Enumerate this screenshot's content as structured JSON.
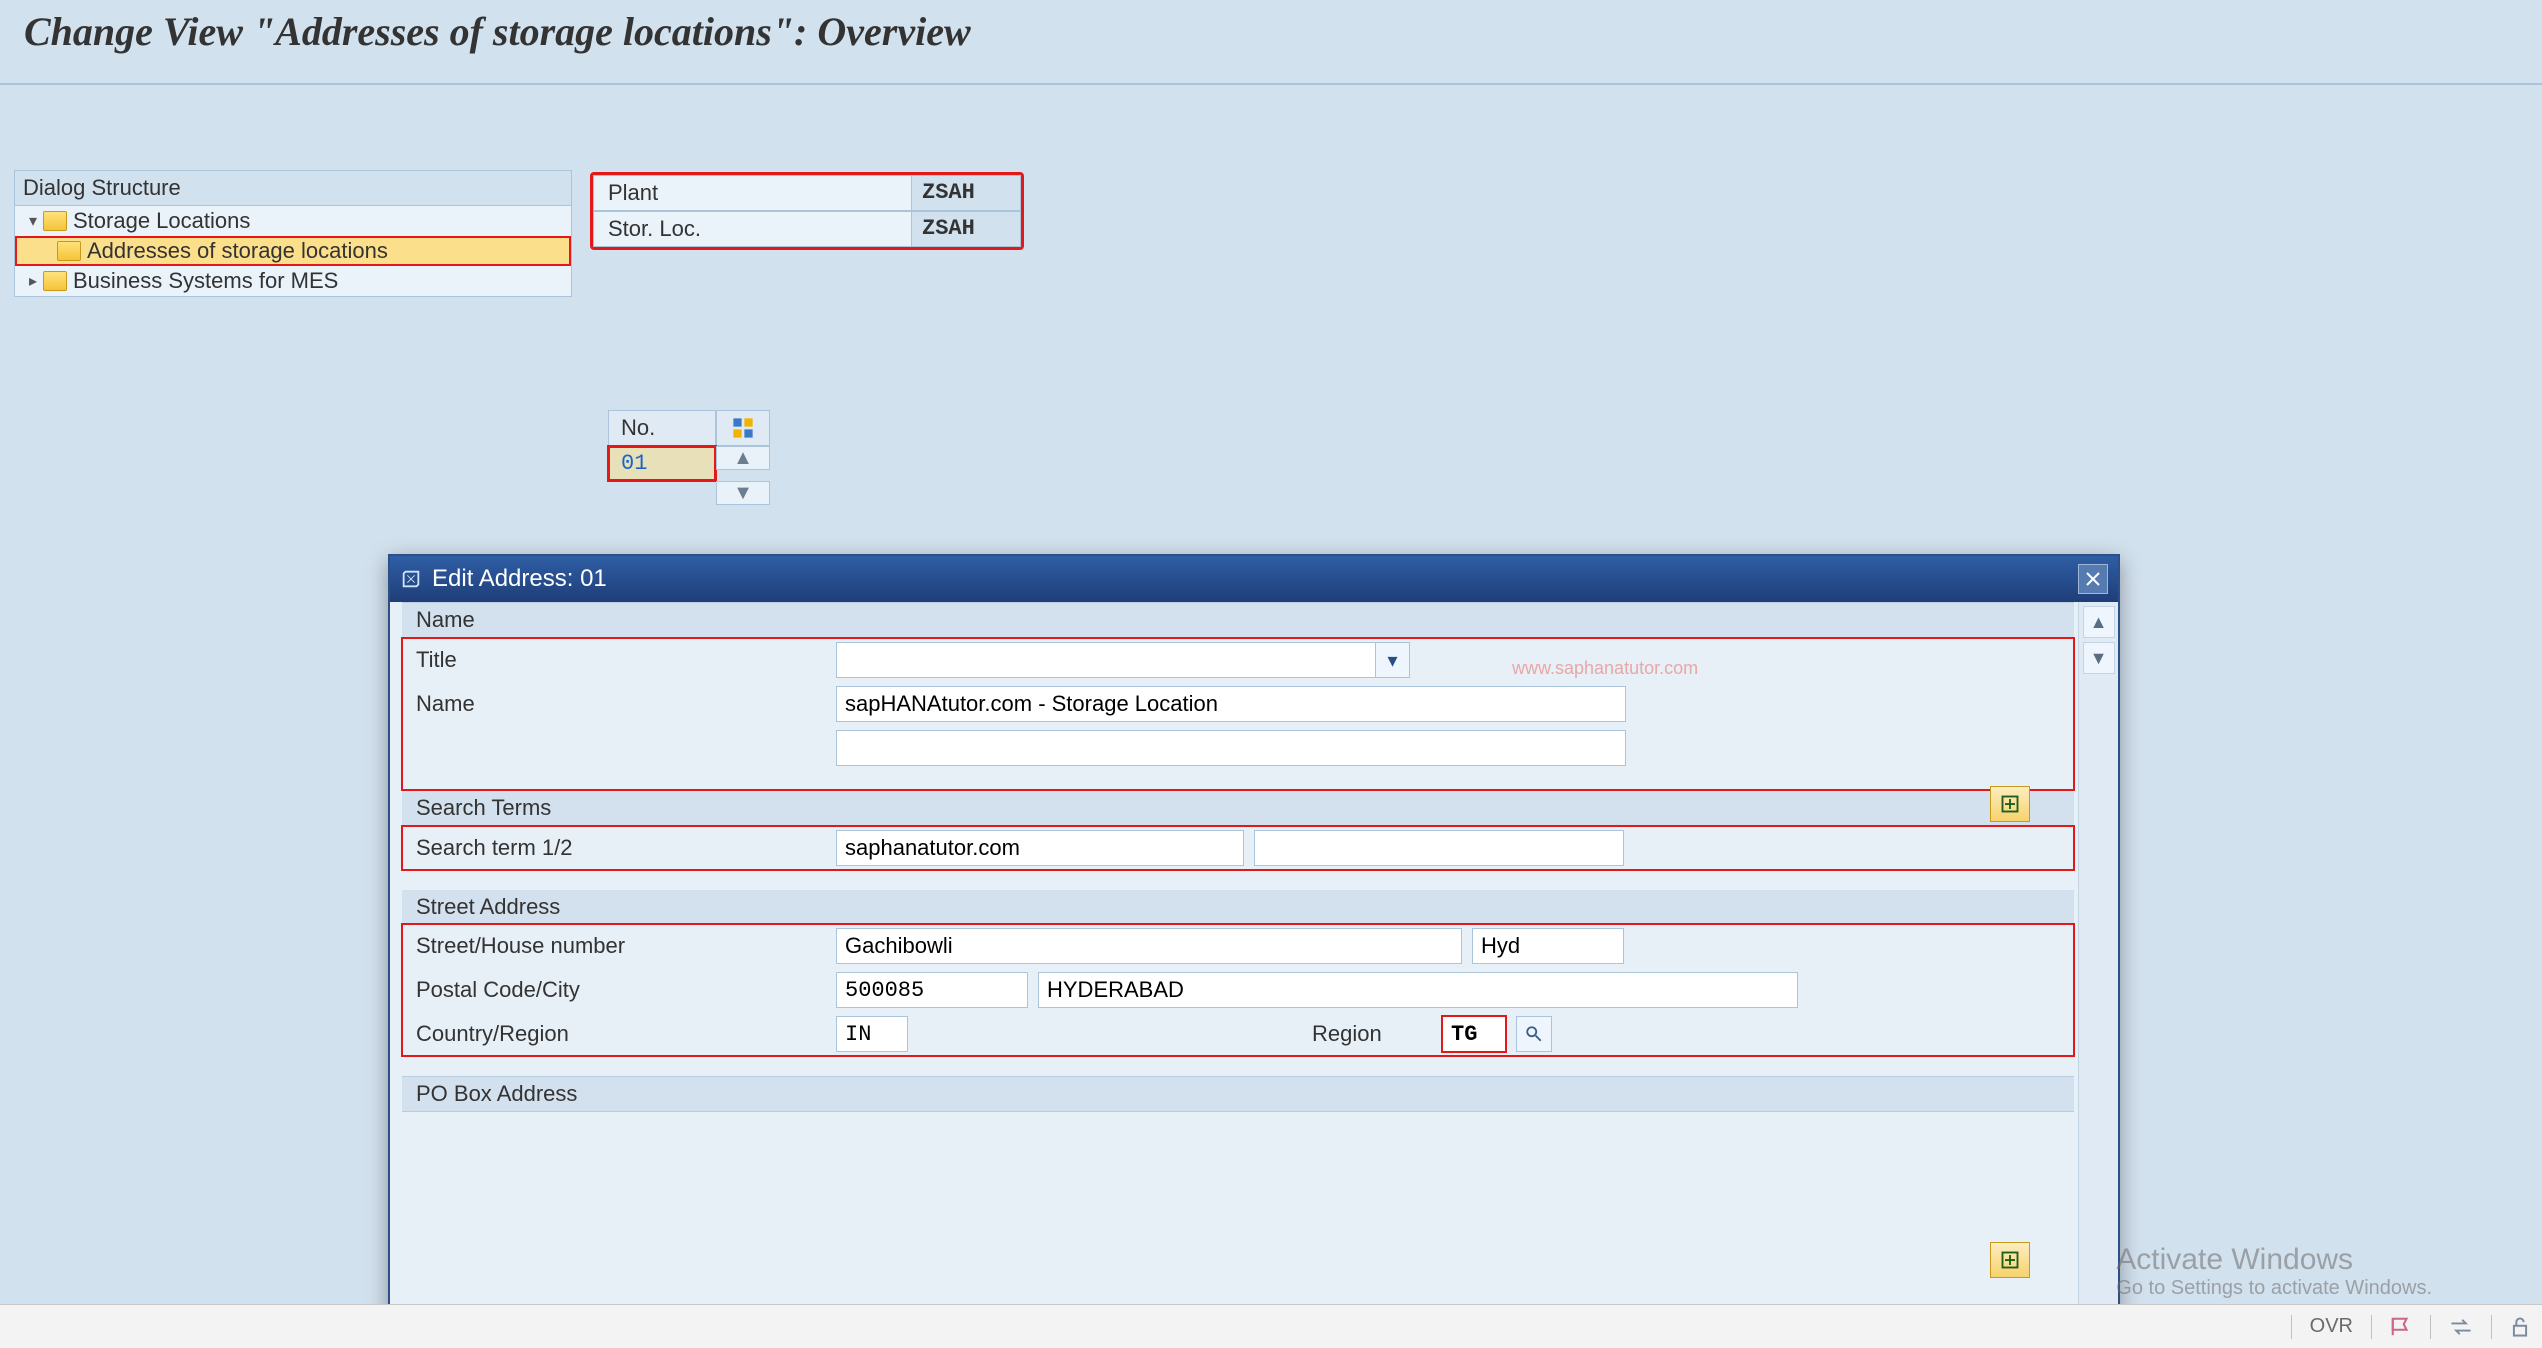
{
  "page_title": "Change View \"Addresses of storage locations\": Overview",
  "dialog_structure": {
    "header": "Dialog Structure",
    "nodes": {
      "root": "Storage Locations",
      "child_selected": "Addresses of storage locations",
      "child2": "Business Systems for MES"
    }
  },
  "header_fields": {
    "plant_label": "Plant",
    "plant_value": "ZSAH",
    "sloc_label": "Stor. Loc.",
    "sloc_value": "ZSAH"
  },
  "no_table": {
    "col": "No.",
    "value": "01"
  },
  "dialog": {
    "title": "Edit Address:  01",
    "sections": {
      "name": "Name",
      "search_terms": "Search Terms",
      "street_address": "Street Address",
      "po_box": "PO Box Address"
    },
    "fields": {
      "title_label": "Title",
      "title_value": "",
      "name_label": "Name",
      "name_value": "sapHANAtutor.com - Storage Location",
      "name2_value": "",
      "search_label": "Search term 1/2",
      "search1": "saphanatutor.com",
      "search2": "",
      "street_label": "Street/House number",
      "street_value": "Gachibowli",
      "houseno_value": "Hyd",
      "postal_label": "Postal Code/City",
      "postal_value": "500085",
      "city_value": "HYDERABAD",
      "country_label": "Country/Region",
      "country_value": "IN",
      "region_label": "Region",
      "region_value": "TG"
    },
    "watermark": "www.saphanatutor.com"
  },
  "statusbar": {
    "mode": "OVR"
  },
  "windows_watermark": {
    "line1": "Activate Windows",
    "line2": "Go to Settings to activate Windows."
  }
}
